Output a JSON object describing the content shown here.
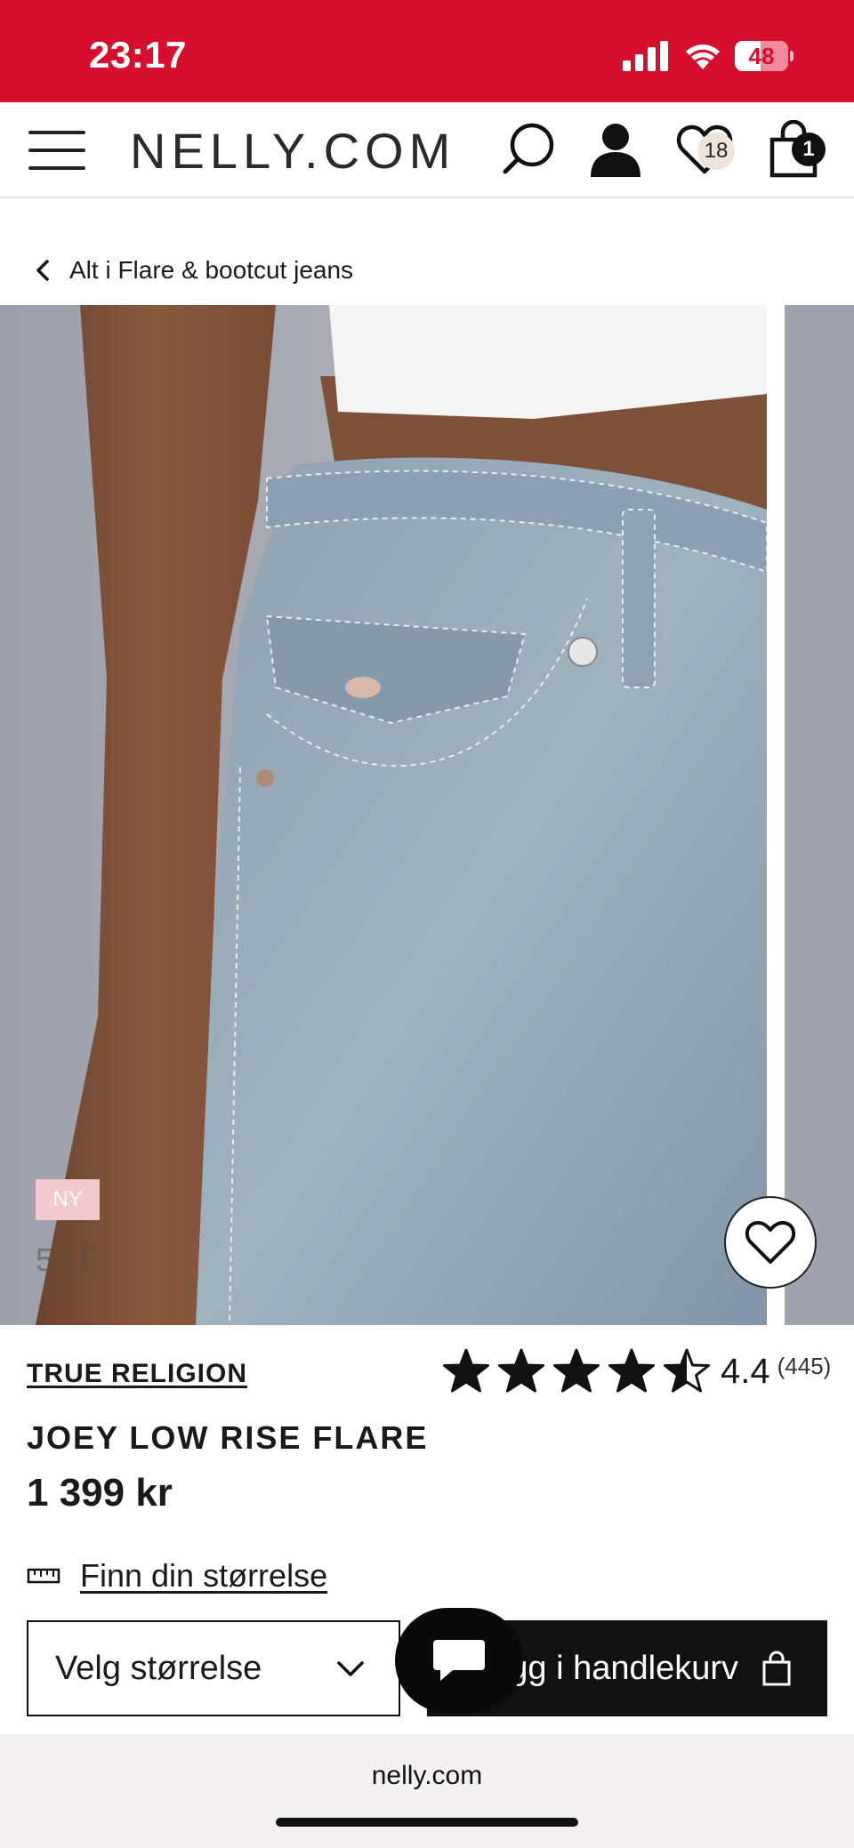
{
  "status_bar": {
    "time": "23:17",
    "battery": "48",
    "battery_level": 0.48
  },
  "header": {
    "logo": "NELLY.COM",
    "wishlist_count": "18",
    "cart_count": "1"
  },
  "breadcrumb": {
    "label": "Alt i Flare & bootcut jeans"
  },
  "gallery": {
    "new_tag": "NY",
    "counter": "5 / 6"
  },
  "product": {
    "brand": "TRUE RELIGION",
    "rating_value": "4.4",
    "rating_count": "(445)",
    "rating_stars": 4.5,
    "name": "JOEY LOW RISE FLARE",
    "price": "1 399 kr"
  },
  "actions": {
    "size_guide": "Finn din størrelse",
    "size_select": "Velg størrelse",
    "add_to_cart": "Legg i handlekurv"
  },
  "browser": {
    "url": "nelly.com"
  },
  "colors": {
    "brand_red": "#d50f2d",
    "new_tag": "#f2c9cc",
    "button_black": "#111111"
  }
}
